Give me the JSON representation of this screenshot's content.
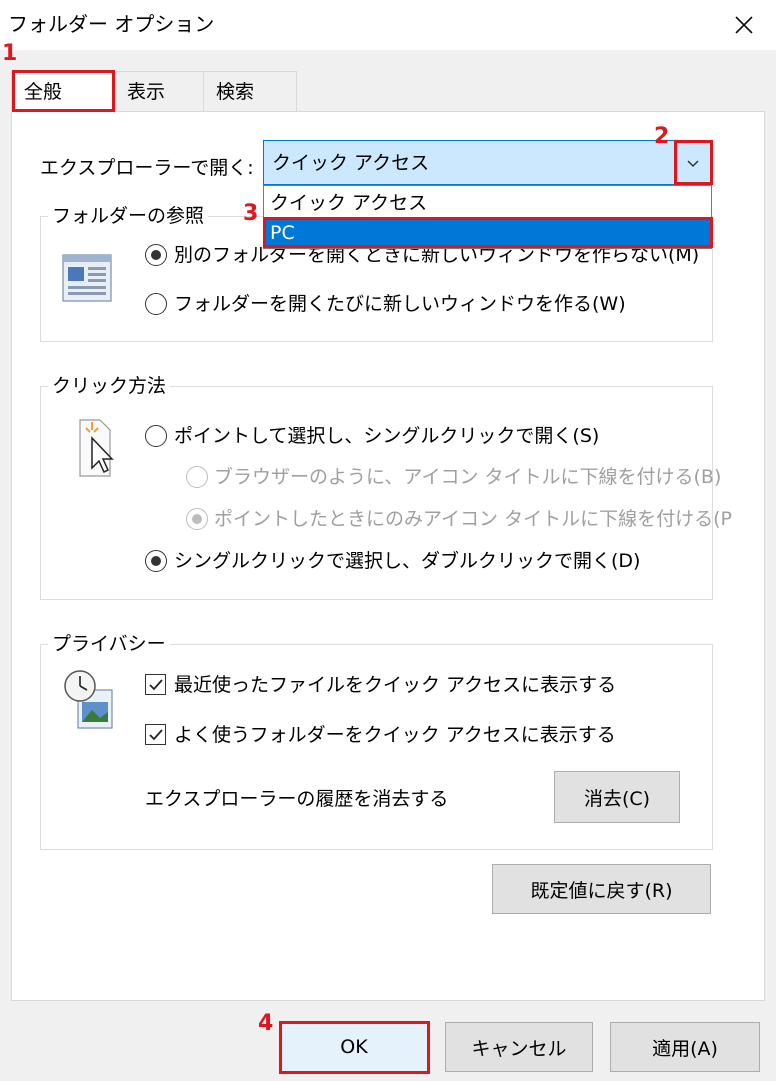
{
  "window": {
    "title": "フォルダー オプション",
    "close_glyph": "✕"
  },
  "tabs": [
    {
      "label": "全般",
      "active": true
    },
    {
      "label": "表示",
      "active": false
    },
    {
      "label": "検索",
      "active": false
    }
  ],
  "general": {
    "open_explorer_label": "エクスプローラーで開く:",
    "open_explorer_value": "クイック アクセス",
    "open_explorer_options": [
      "クイック アクセス",
      "PC"
    ],
    "open_explorer_highlighted": "PC",
    "browse_folders": {
      "legend": "フォルダーの参照",
      "options": [
        {
          "label": "別のフォルダーを開くときに新しいウィンドウを作らない(M)",
          "selected": true
        },
        {
          "label": "フォルダーを開くたびに新しいウィンドウを作る(W)",
          "selected": false
        }
      ]
    },
    "click_method": {
      "legend": "クリック方法",
      "single_click": {
        "label": "ポイントして選択し、シングルクリックで開く(S)",
        "selected": false
      },
      "underline_browser": {
        "label": "ブラウザーのように、アイコン タイトルに下線を付ける(B)",
        "selected": false,
        "enabled": false
      },
      "underline_point": {
        "label": "ポイントしたときにのみアイコン タイトルに下線を付ける(P",
        "selected": true,
        "enabled": false
      },
      "double_click": {
        "label": "シングルクリックで選択し、ダブルクリックで開く(D)",
        "selected": true
      }
    },
    "privacy": {
      "legend": "プライバシー",
      "recent_files": {
        "label": "最近使ったファイルをクイック アクセスに表示する",
        "checked": true
      },
      "frequent_folders": {
        "label": "よく使うフォルダーをクイック アクセスに表示する",
        "checked": true
      },
      "clear_history_label": "エクスプローラーの履歴を消去する",
      "clear_button": "消去(C)"
    },
    "restore_defaults_button": "既定値に戻す(R)"
  },
  "footer": {
    "ok": "OK",
    "cancel": "キャンセル",
    "apply": "適用(A)"
  },
  "annotations": {
    "step1": "1",
    "step2": "2",
    "step3": "3",
    "step4": "4",
    "color": "#e0161e"
  },
  "colors": {
    "accent": "#0078d7",
    "combo_bg": "#cce8ff",
    "highlight_border": "#e0161e"
  }
}
